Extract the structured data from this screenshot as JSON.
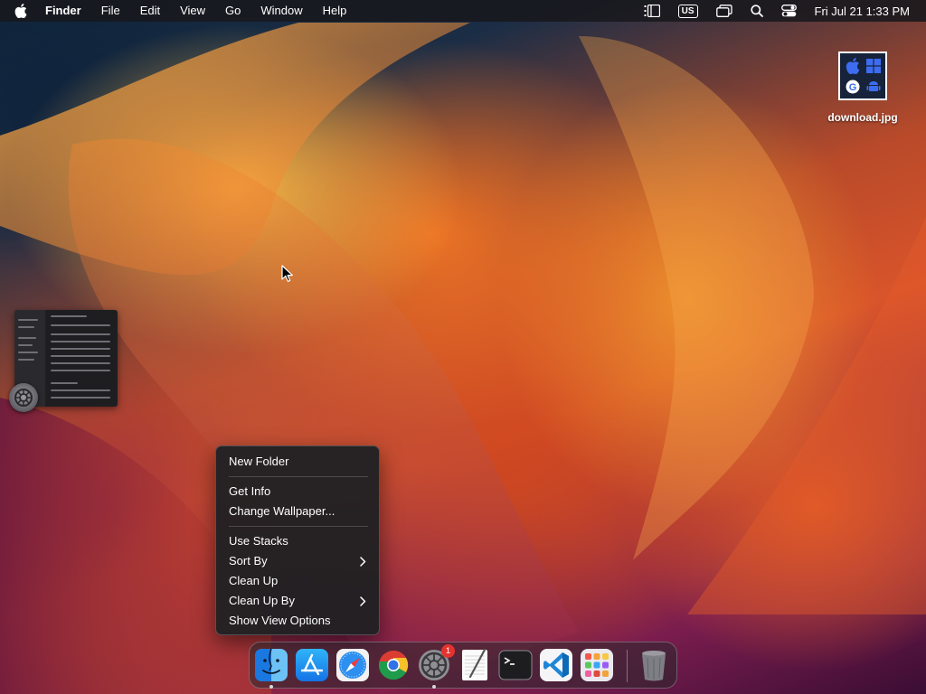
{
  "menubar": {
    "app_name": "Finder",
    "menus": [
      "File",
      "Edit",
      "View",
      "Go",
      "Window",
      "Help"
    ],
    "input_source": "US",
    "clock": "Fri Jul 21  1:33 PM",
    "icons": [
      "apple-logo-icon",
      "list-icon",
      "input-source-icon",
      "display-mirror-icon",
      "spotlight-search-icon",
      "control-center-icon"
    ]
  },
  "desktop": {
    "file": {
      "name": "download.jpg"
    }
  },
  "context_menu": {
    "groups": [
      [
        "New Folder"
      ],
      [
        "Get Info",
        "Change Wallpaper..."
      ],
      [
        "Use Stacks",
        "Sort By",
        "Clean Up",
        "Clean Up By",
        "Show View Options"
      ]
    ],
    "submenu_items": [
      "Sort By",
      "Clean Up By"
    ]
  },
  "dock": {
    "apps": [
      {
        "name": "Finder",
        "icon": "finder-icon",
        "running": true
      },
      {
        "name": "App Store",
        "icon": "app-store-icon",
        "running": false
      },
      {
        "name": "Safari",
        "icon": "safari-icon",
        "running": false
      },
      {
        "name": "Chrome",
        "icon": "chrome-icon",
        "running": false
      },
      {
        "name": "System Settings",
        "icon": "system-settings-icon",
        "running": true,
        "badge": "1"
      },
      {
        "name": "TextEdit",
        "icon": "textedit-icon",
        "running": false
      },
      {
        "name": "Terminal",
        "icon": "terminal-icon",
        "running": false
      },
      {
        "name": "VS Code",
        "icon": "vscode-icon",
        "running": false
      },
      {
        "name": "Launchpad",
        "icon": "launchpad-icon",
        "running": false
      },
      {
        "name": "Trash",
        "icon": "trash-icon",
        "running": false
      }
    ]
  },
  "colors": {
    "menubar_bg": "#18181c",
    "menu_bg": "#202022",
    "badge_red": "#e5322e"
  }
}
